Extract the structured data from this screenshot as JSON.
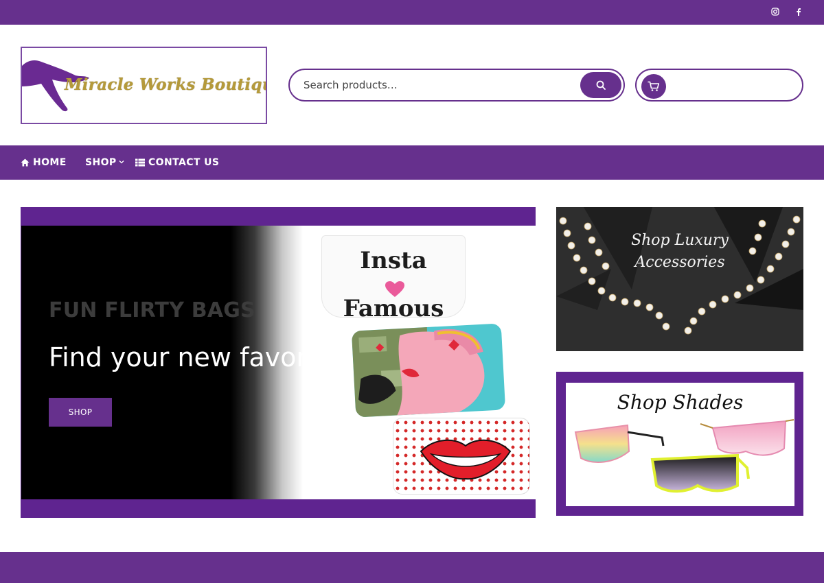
{
  "topbar": {
    "social": [
      {
        "name": "instagram-icon"
      },
      {
        "name": "facebook-icon"
      }
    ]
  },
  "logo": {
    "text": "Miracle Works Boutique"
  },
  "search": {
    "placeholder": "Search products…"
  },
  "nav": {
    "home_label": "HOME",
    "shop_label": "SHOP",
    "contact_label": "CONTACT US"
  },
  "slider": {
    "subtitle": "FUN FLIRTY BAGS",
    "title": "Find your new favorite!",
    "button_label": "SHOP",
    "bag1_line1": "Insta",
    "bag1_line2": "Famous"
  },
  "promos": {
    "accessories_line1": "Shop Luxury",
    "accessories_line2": "Accessories",
    "shades_text": "Shop Shades"
  },
  "colors": {
    "brand_purple": "#66308d",
    "slider_purple": "#5f2490"
  }
}
